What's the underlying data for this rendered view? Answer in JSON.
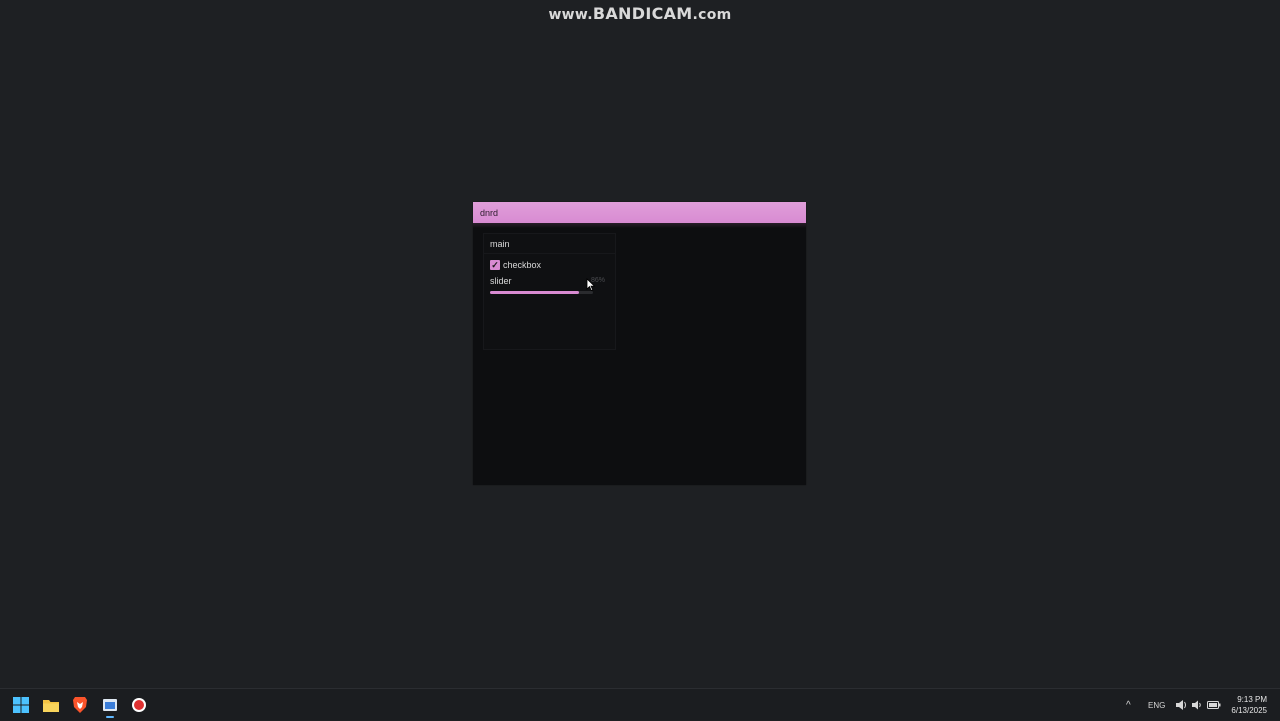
{
  "watermark": {
    "prefix": "www.",
    "brand": "BANDICAM",
    "suffix": ".com"
  },
  "window": {
    "title": "dnrd",
    "accent_color": "#d88bd2",
    "panel": {
      "title": "main",
      "checkbox": {
        "label": "checkbox",
        "checked": true,
        "check_glyph": "✓"
      },
      "slider": {
        "label": "slider",
        "value_text": "86%",
        "value": 0.86
      }
    }
  },
  "taskbar": {
    "icons": [
      "windows-start-icon",
      "file-explorer-icon",
      "brave-browser-icon",
      "app-window-icon",
      "bandicam-record-icon"
    ],
    "tray": {
      "overflow_glyph": "^",
      "language": "ENG",
      "time": "9:13 PM",
      "date": "6/13/2025"
    }
  }
}
